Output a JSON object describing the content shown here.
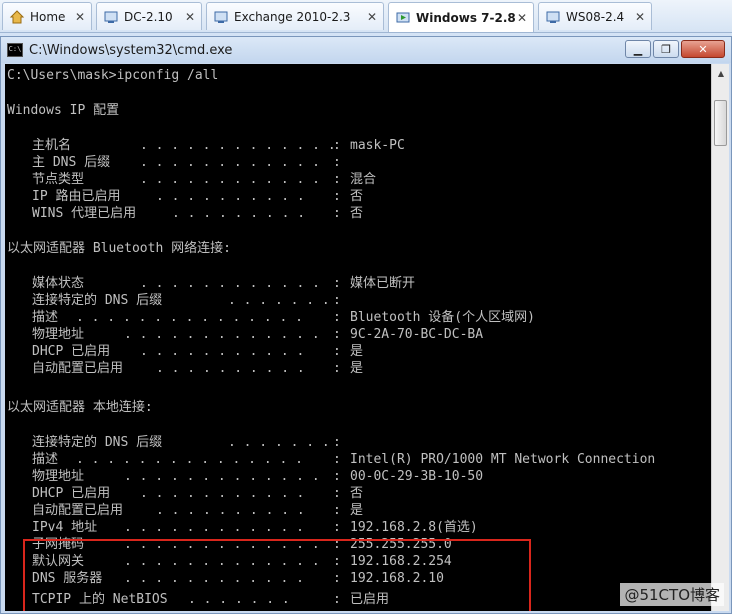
{
  "tabs": [
    {
      "label": "Home",
      "icon": "home-icon",
      "active": false
    },
    {
      "label": "DC-2.10",
      "icon": "vm-icon",
      "active": false
    },
    {
      "label": "Exchange 2010-2.3",
      "icon": "vm-icon",
      "active": false
    },
    {
      "label": "Windows 7-2.8",
      "icon": "vm-running-icon",
      "active": true
    },
    {
      "label": "WS08-2.4",
      "icon": "vm-icon",
      "active": false
    }
  ],
  "window": {
    "title": "C:\\Windows\\system32\\cmd.exe",
    "minimize": "▁",
    "restore": "❐",
    "close": "✕"
  },
  "console": {
    "prompt": "C:\\Users\\mask>ipconfig /all",
    "header": "Windows IP 配置",
    "global": [
      {
        "label": "主机名",
        "dots": ". . . . . . . . . . . . .",
        "value": "mask-PC"
      },
      {
        "label": "主 DNS 后缀",
        "dots": ". . . . . . . . . . . .",
        "value": ""
      },
      {
        "label": "节点类型",
        "dots": ". . . . . . . . . . . .",
        "value": "混合"
      },
      {
        "label": "IP 路由已启用",
        "dots": ". . . . . . . . . .",
        "value": "否"
      },
      {
        "label": "WINS 代理已启用",
        "dots": ". . . . . . . . .",
        "value": "否"
      }
    ],
    "adapter1_title": "以太网适配器 Bluetooth 网络连接:",
    "adapter1": [
      {
        "label": "媒体状态",
        "dots": ". . . . . . . . . . . .",
        "value": "媒体已断开"
      },
      {
        "label": "连接特定的 DNS 后缀",
        "dots": ". . . . . . .",
        "value": ""
      },
      {
        "label": "描述",
        "dots": ". . . . . . . . . . . . . . .",
        "value": "Bluetooth 设备(个人区域网)"
      },
      {
        "label": "物理地址",
        "dots": ". . . . . . . . . . . . .",
        "value": "9C-2A-70-BC-DC-BA"
      },
      {
        "label": "DHCP 已启用",
        "dots": ". . . . . . . . . . .",
        "value": "是"
      },
      {
        "label": "自动配置已启用",
        "dots": ". . . . . . . . . .",
        "value": "是"
      }
    ],
    "adapter2_title": "以太网适配器 本地连接:",
    "adapter2": [
      {
        "label": "连接特定的 DNS 后缀",
        "dots": ". . . . . . .",
        "value": ""
      },
      {
        "label": "描述",
        "dots": ". . . . . . . . . . . . . . .",
        "value": "Intel(R) PRO/1000 MT Network Connection"
      },
      {
        "label": "物理地址",
        "dots": ". . . . . . . . . . . . .",
        "value": "00-0C-29-3B-10-50"
      },
      {
        "label": "DHCP 已启用",
        "dots": ". . . . . . . . . . .",
        "value": "否"
      },
      {
        "label": "自动配置已启用",
        "dots": ". . . . . . . . . .",
        "value": "是"
      },
      {
        "label": "IPv4 地址",
        "dots": ". . . . . . . . . . . .",
        "value": "192.168.2.8(首选)"
      },
      {
        "label": "子网掩码",
        "dots": ". . . . . . . . . . . . .",
        "value": "255.255.255.0"
      },
      {
        "label": "默认网关",
        "dots": ". . . . . . . . . . . . .",
        "value": "192.168.2.254"
      },
      {
        "label": "DNS 服务器",
        "dots": ". . . . . . . . . . . .",
        "value": "192.168.2.10"
      },
      {
        "label": "TCPIP 上的 NetBIOS",
        "dots": ". . . . . . .",
        "value": "已启用"
      }
    ]
  },
  "watermark": "@51CTO博客",
  "colors": {
    "console_bg": "#000000",
    "console_text": "#c0c0c0",
    "highlight": "#d9261c"
  }
}
